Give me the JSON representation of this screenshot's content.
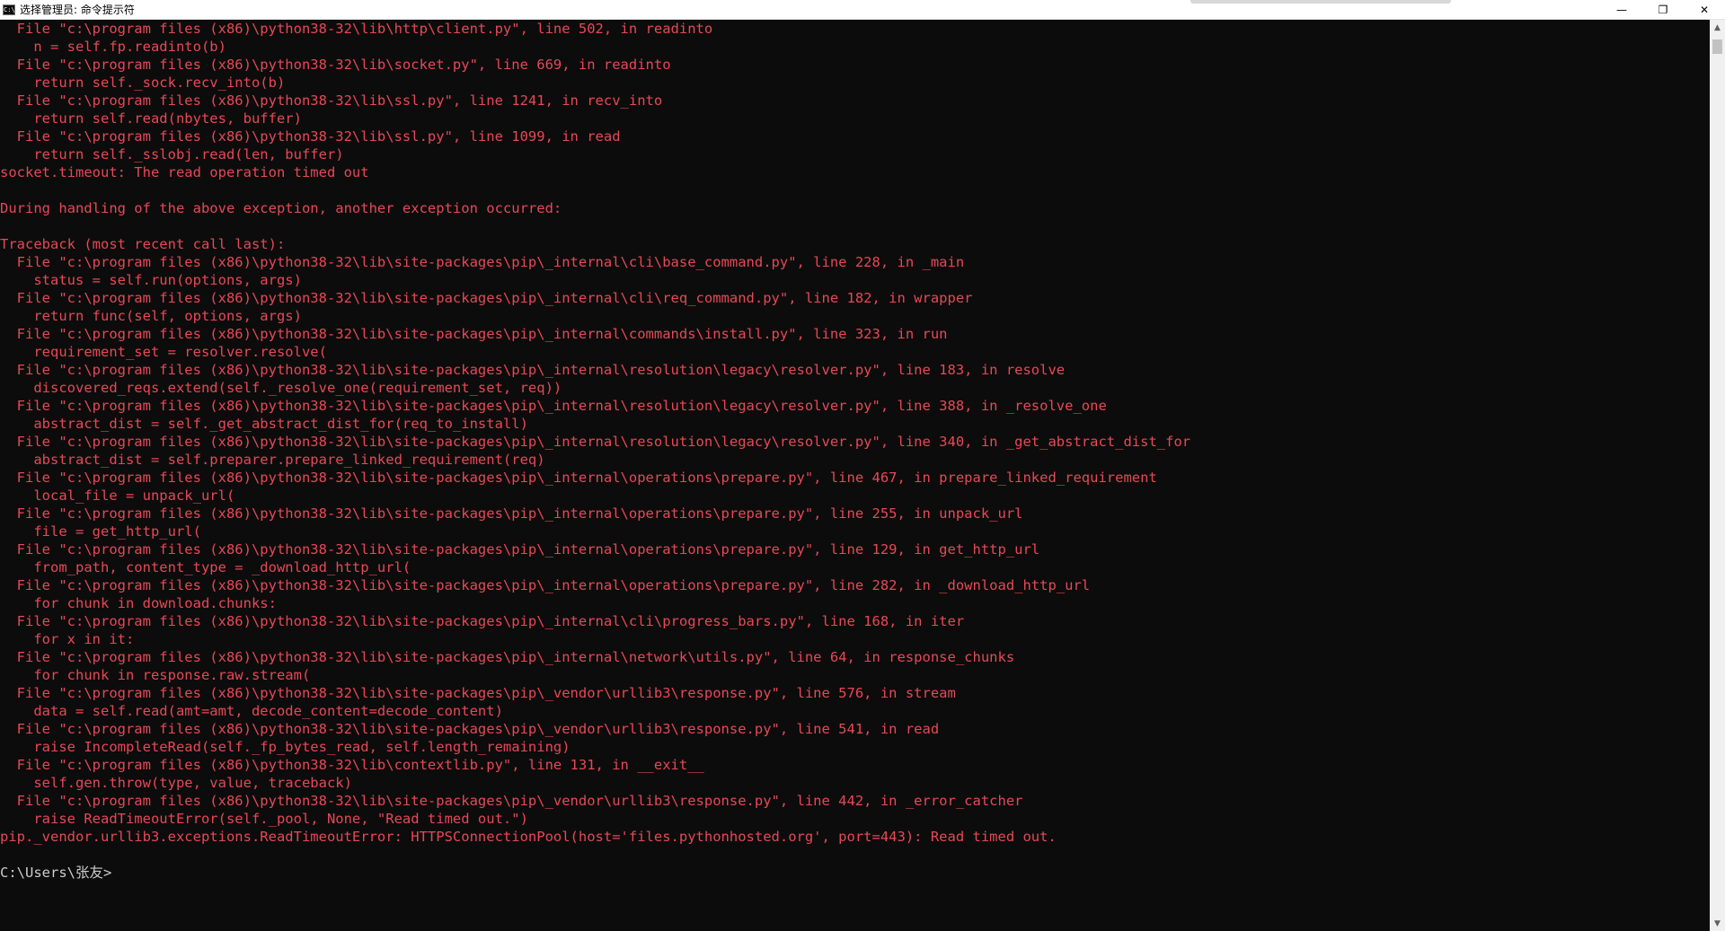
{
  "window": {
    "title": "选择管理员: 命令提示符",
    "app_icon_text": "C:\\",
    "minimize_glyph": "—",
    "maximize_glyph": "❐",
    "close_glyph": "✕"
  },
  "console": {
    "lines": [
      "  File \"c:\\program files (x86)\\python38-32\\lib\\http\\client.py\", line 502, in readinto",
      "    n = self.fp.readinto(b)",
      "  File \"c:\\program files (x86)\\python38-32\\lib\\socket.py\", line 669, in readinto",
      "    return self._sock.recv_into(b)",
      "  File \"c:\\program files (x86)\\python38-32\\lib\\ssl.py\", line 1241, in recv_into",
      "    return self.read(nbytes, buffer)",
      "  File \"c:\\program files (x86)\\python38-32\\lib\\ssl.py\", line 1099, in read",
      "    return self._sslobj.read(len, buffer)",
      "socket.timeout: The read operation timed out",
      "",
      "During handling of the above exception, another exception occurred:",
      "",
      "Traceback (most recent call last):",
      "  File \"c:\\program files (x86)\\python38-32\\lib\\site-packages\\pip\\_internal\\cli\\base_command.py\", line 228, in _main",
      "    status = self.run(options, args)",
      "  File \"c:\\program files (x86)\\python38-32\\lib\\site-packages\\pip\\_internal\\cli\\req_command.py\", line 182, in wrapper",
      "    return func(self, options, args)",
      "  File \"c:\\program files (x86)\\python38-32\\lib\\site-packages\\pip\\_internal\\commands\\install.py\", line 323, in run",
      "    requirement_set = resolver.resolve(",
      "  File \"c:\\program files (x86)\\python38-32\\lib\\site-packages\\pip\\_internal\\resolution\\legacy\\resolver.py\", line 183, in resolve",
      "    discovered_reqs.extend(self._resolve_one(requirement_set, req))",
      "  File \"c:\\program files (x86)\\python38-32\\lib\\site-packages\\pip\\_internal\\resolution\\legacy\\resolver.py\", line 388, in _resolve_one",
      "    abstract_dist = self._get_abstract_dist_for(req_to_install)",
      "  File \"c:\\program files (x86)\\python38-32\\lib\\site-packages\\pip\\_internal\\resolution\\legacy\\resolver.py\", line 340, in _get_abstract_dist_for",
      "    abstract_dist = self.preparer.prepare_linked_requirement(req)",
      "  File \"c:\\program files (x86)\\python38-32\\lib\\site-packages\\pip\\_internal\\operations\\prepare.py\", line 467, in prepare_linked_requirement",
      "    local_file = unpack_url(",
      "  File \"c:\\program files (x86)\\python38-32\\lib\\site-packages\\pip\\_internal\\operations\\prepare.py\", line 255, in unpack_url",
      "    file = get_http_url(",
      "  File \"c:\\program files (x86)\\python38-32\\lib\\site-packages\\pip\\_internal\\operations\\prepare.py\", line 129, in get_http_url",
      "    from_path, content_type = _download_http_url(",
      "  File \"c:\\program files (x86)\\python38-32\\lib\\site-packages\\pip\\_internal\\operations\\prepare.py\", line 282, in _download_http_url",
      "    for chunk in download.chunks:",
      "  File \"c:\\program files (x86)\\python38-32\\lib\\site-packages\\pip\\_internal\\cli\\progress_bars.py\", line 168, in iter",
      "    for x in it:",
      "  File \"c:\\program files (x86)\\python38-32\\lib\\site-packages\\pip\\_internal\\network\\utils.py\", line 64, in response_chunks",
      "    for chunk in response.raw.stream(",
      "  File \"c:\\program files (x86)\\python38-32\\lib\\site-packages\\pip\\_vendor\\urllib3\\response.py\", line 576, in stream",
      "    data = self.read(amt=amt, decode_content=decode_content)",
      "  File \"c:\\program files (x86)\\python38-32\\lib\\site-packages\\pip\\_vendor\\urllib3\\response.py\", line 541, in read",
      "    raise IncompleteRead(self._fp_bytes_read, self.length_remaining)",
      "  File \"c:\\program files (x86)\\python38-32\\lib\\contextlib.py\", line 131, in __exit__",
      "    self.gen.throw(type, value, traceback)",
      "  File \"c:\\program files (x86)\\python38-32\\lib\\site-packages\\pip\\_vendor\\urllib3\\response.py\", line 442, in _error_catcher",
      "    raise ReadTimeoutError(self._pool, None, \"Read timed out.\")",
      "pip._vendor.urllib3.exceptions.ReadTimeoutError: HTTPSConnectionPool(host='files.pythonhosted.org', port=443): Read timed out.",
      "",
      "C:\\Users\\张友>"
    ],
    "error_color": "#e74856",
    "prompt_color": "#cccccc",
    "background": "#0c0c0c"
  },
  "scrollbar": {
    "up_glyph": "▲",
    "down_glyph": "▼"
  }
}
